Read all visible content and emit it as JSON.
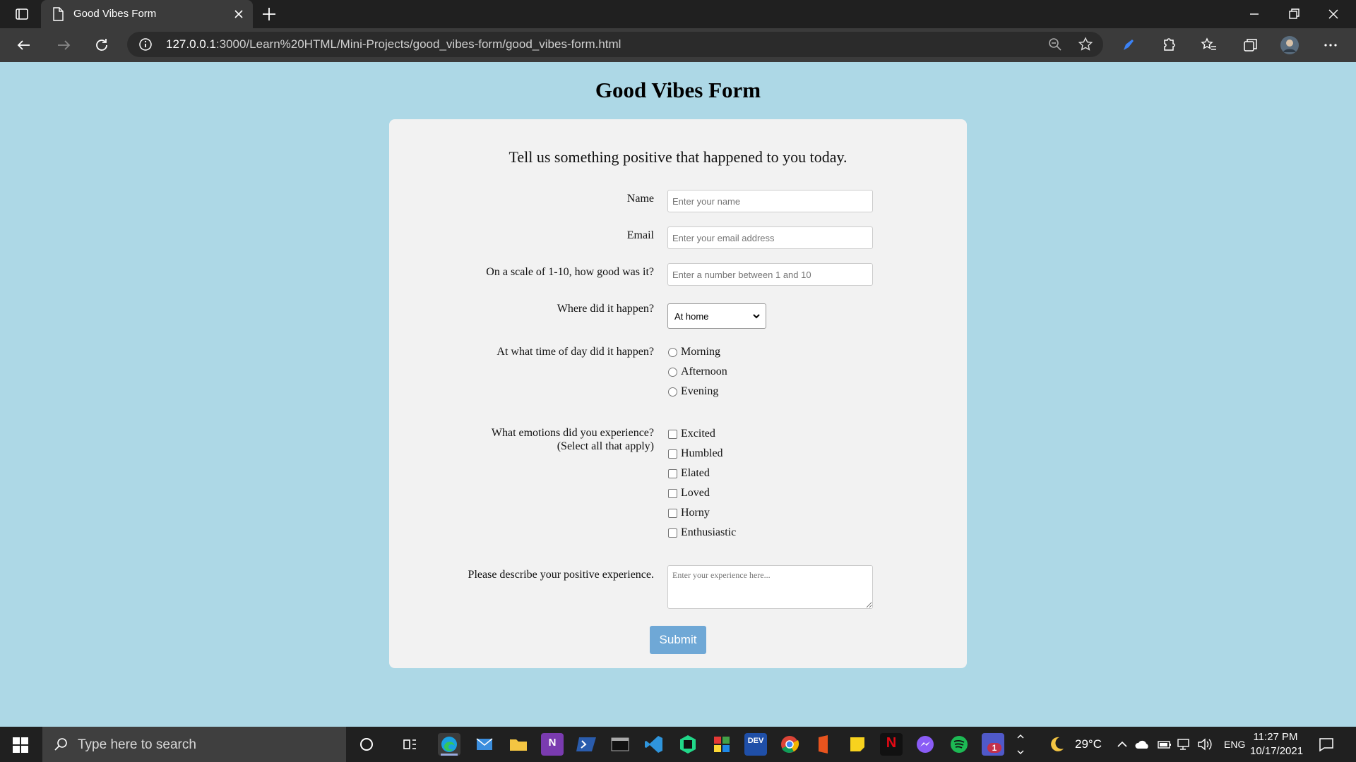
{
  "browser": {
    "tab_title": "Good Vibes Form",
    "url_host": "127.0.0.1",
    "url_path": ":3000/Learn%20HTML/Mini-Projects/good_vibes-form/good_vibes-form.html"
  },
  "form": {
    "heading": "Good Vibes Form",
    "intro": "Tell us something positive that happened to you today.",
    "name_label": "Name",
    "name_placeholder": "Enter your name",
    "email_label": "Email",
    "email_placeholder": "Enter your email address",
    "scale_label": "On a scale of 1-10, how good was it?",
    "scale_placeholder": "Enter a number between 1 and 10",
    "where_label": "Where did it happen?",
    "where_value": "At home",
    "time_label": "At what time of day did it happen?",
    "time_options": [
      "Morning",
      "Afternoon",
      "Evening"
    ],
    "emotions_label": "What emotions did you experience?",
    "emotions_sublabel": "(Select all that apply)",
    "emotions_options": [
      "Excited",
      "Humbled",
      "Elated",
      "Loved",
      "Horny",
      "Enthusiastic"
    ],
    "describe_label": "Please describe your positive experience.",
    "describe_placeholder": "Enter your experience here...",
    "submit_label": "Submit"
  },
  "taskbar": {
    "search_placeholder": "Type here to search",
    "weather": "29°C",
    "language": "ENG",
    "time": "11:27 PM",
    "date": "10/17/2021",
    "netflix_label": "N",
    "onenote_label": "N",
    "dev_label": "DEV",
    "teams_badge": "1"
  },
  "colors": {
    "page_bg": "#add8e6",
    "card_bg": "#f2f2f2",
    "submit_bg": "#6fa8d6"
  }
}
